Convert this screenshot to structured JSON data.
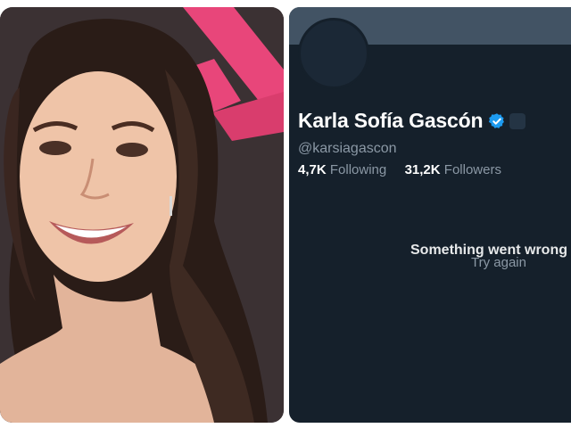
{
  "profile": {
    "display_name": "Karla Sofía Gascón",
    "handle": "@karsiagascon",
    "following_count": "4,7K",
    "following_label": "Following",
    "followers_count": "31,2K",
    "followers_label": "Followers",
    "verified_icon": "verified-badge-icon",
    "verified_color": "#1d9bf0"
  },
  "error": {
    "message": "Something went wrong",
    "retry_label": "Try again"
  },
  "colors": {
    "panel_background": "#15202b",
    "banner": "#425364",
    "text_primary": "#ffffff",
    "text_secondary": "#8b98a5",
    "photo_accent": "#e8467a"
  }
}
